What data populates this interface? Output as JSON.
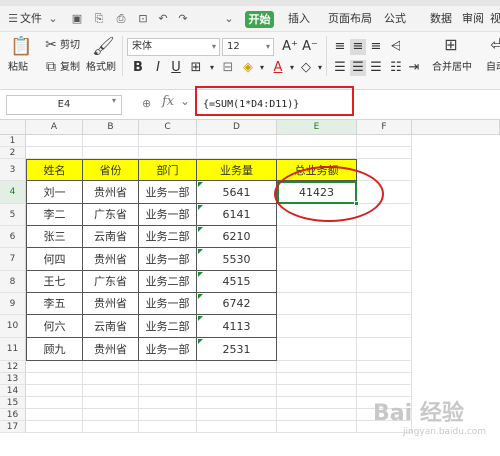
{
  "menu": {
    "items": [
      "文件",
      "开始",
      "插入",
      "页面布局",
      "公式",
      "数据",
      "审阅",
      "视图"
    ]
  },
  "toolbar": {
    "cut": "剪切",
    "paste": "粘贴",
    "copy": "复制",
    "format_painter": "格式刷",
    "font_name": "宋体",
    "font_size": "12",
    "merge_center": "合并居中",
    "auto_wrap_partial": "自动"
  },
  "formula_bar": {
    "cell_ref": "E4",
    "fx": "fx",
    "formula": "{=SUM(1*D4:D11)}"
  },
  "sheet": {
    "columns": [
      "A",
      "B",
      "C",
      "D",
      "E",
      "F"
    ],
    "rows": [
      "1",
      "2",
      "3",
      "4",
      "5",
      "6",
      "7",
      "8",
      "9",
      "10",
      "11",
      "12",
      "13",
      "14",
      "15",
      "16",
      "17"
    ],
    "headers": [
      "姓名",
      "省份",
      "部门",
      "业务量",
      "总业务额"
    ],
    "data": [
      [
        "刘一",
        "贵州省",
        "业务一部",
        "5641"
      ],
      [
        "李二",
        "广东省",
        "业务一部",
        "6141"
      ],
      [
        "张三",
        "云南省",
        "业务二部",
        "6210"
      ],
      [
        "何四",
        "贵州省",
        "业务一部",
        "5530"
      ],
      [
        "王七",
        "广东省",
        "业务二部",
        "4515"
      ],
      [
        "李五",
        "贵州省",
        "业务一部",
        "6742"
      ],
      [
        "何六",
        "云南省",
        "业务二部",
        "4113"
      ],
      [
        "顾九",
        "贵州省",
        "业务一部",
        "2531"
      ]
    ],
    "total": "41423"
  },
  "watermark": {
    "main": "Bai 经验",
    "sub": "jingyan.baidu.com"
  },
  "colors": {
    "header_fill": "#ffff00",
    "selection": "#1f8b3a",
    "annotation": "#e02020",
    "start_tab": "#3ea650"
  }
}
